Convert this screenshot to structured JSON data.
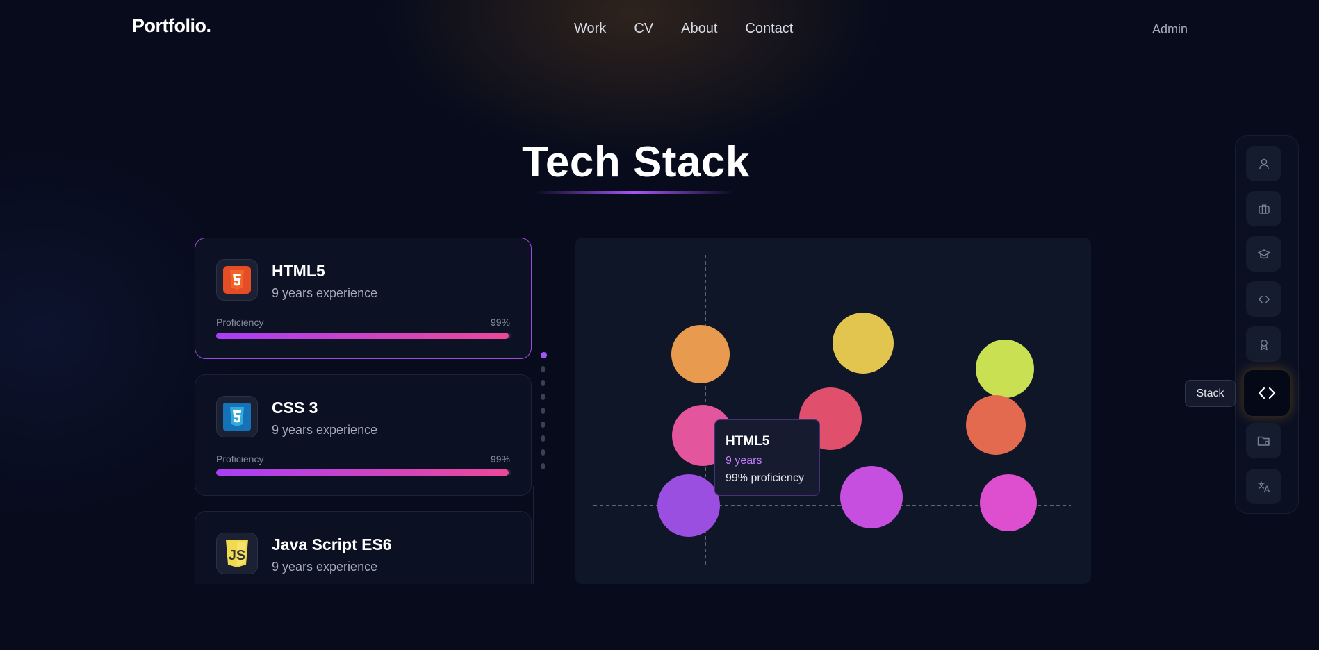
{
  "header": {
    "logo": "Portfolio.",
    "nav": [
      "Work",
      "CV",
      "About",
      "Contact"
    ],
    "admin": "Admin"
  },
  "section": {
    "title": "Tech Stack"
  },
  "skills": [
    {
      "name": "HTML5",
      "experience": "9 years experience",
      "proficiency_label": "Proficiency",
      "proficiency_text": "99%",
      "proficiency": 99,
      "icon": "html5-icon",
      "color": "#e44d26",
      "active": true
    },
    {
      "name": "CSS 3",
      "experience": "9 years experience",
      "proficiency_label": "Proficiency",
      "proficiency_text": "99%",
      "proficiency": 99,
      "icon": "css3-icon",
      "color": "#1572b6",
      "active": false
    },
    {
      "name": "Java Script ES6",
      "experience": "9 years experience",
      "icon": "javascript-icon",
      "color": "#f0db4f",
      "active": false
    }
  ],
  "chart_data": {
    "type": "scatter",
    "bubble_colors": [
      "#e89a4e",
      "#e2c54f",
      "#c9e052",
      "#e3559c",
      "#e0506c",
      "#e36a4e",
      "#9b4fe0",
      "#c74fe0",
      "#dd4fce"
    ],
    "tooltip": {
      "name": "HTML5",
      "years": "9 years",
      "proficiency": "99% proficiency"
    }
  },
  "sidebar": {
    "items": [
      "user-icon",
      "briefcase-icon",
      "graduation-cap-icon",
      "code-icon",
      "award-icon",
      "code-brackets-icon",
      "folder-icon",
      "translate-icon"
    ],
    "active_index": 5,
    "active_tooltip": "Stack"
  },
  "colors": {
    "accent": "#a855f7",
    "bar_gradient_end": "#ec4899",
    "background": "#070b1c"
  }
}
